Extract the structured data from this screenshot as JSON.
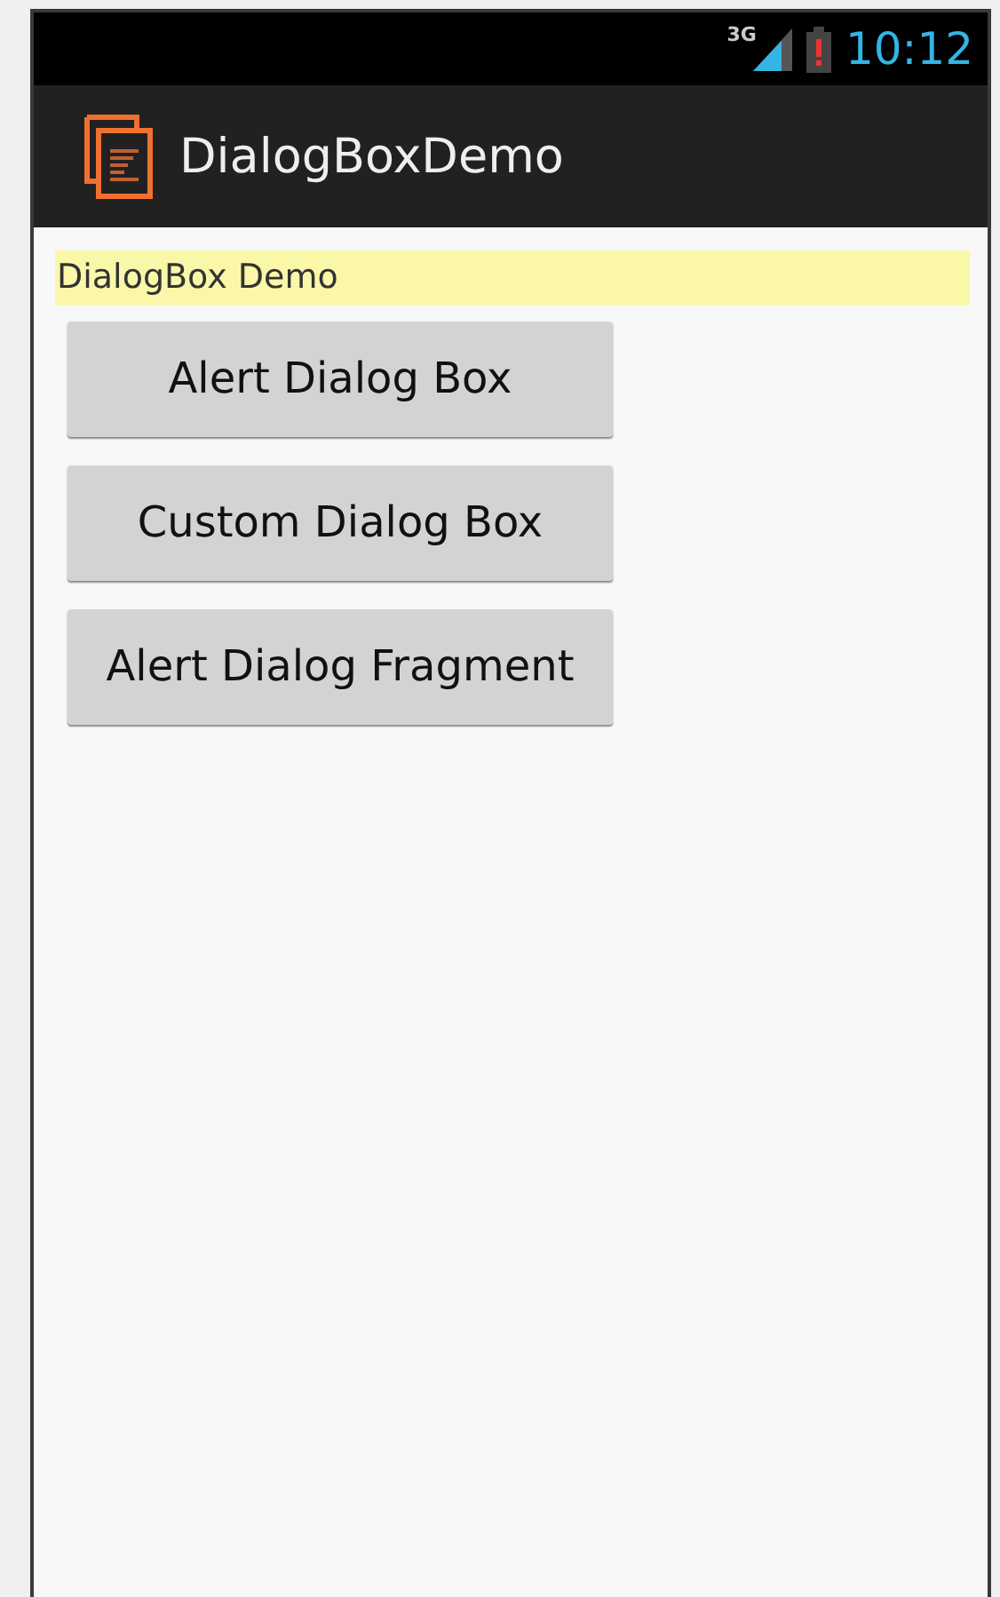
{
  "status_bar": {
    "network": "3G",
    "time": "10:12"
  },
  "action_bar": {
    "title": "DialogBoxDemo"
  },
  "label": "DialogBox Demo",
  "buttons": [
    "Alert Dialog Box",
    "Custom Dialog Box",
    "Alert Dialog Fragment"
  ]
}
